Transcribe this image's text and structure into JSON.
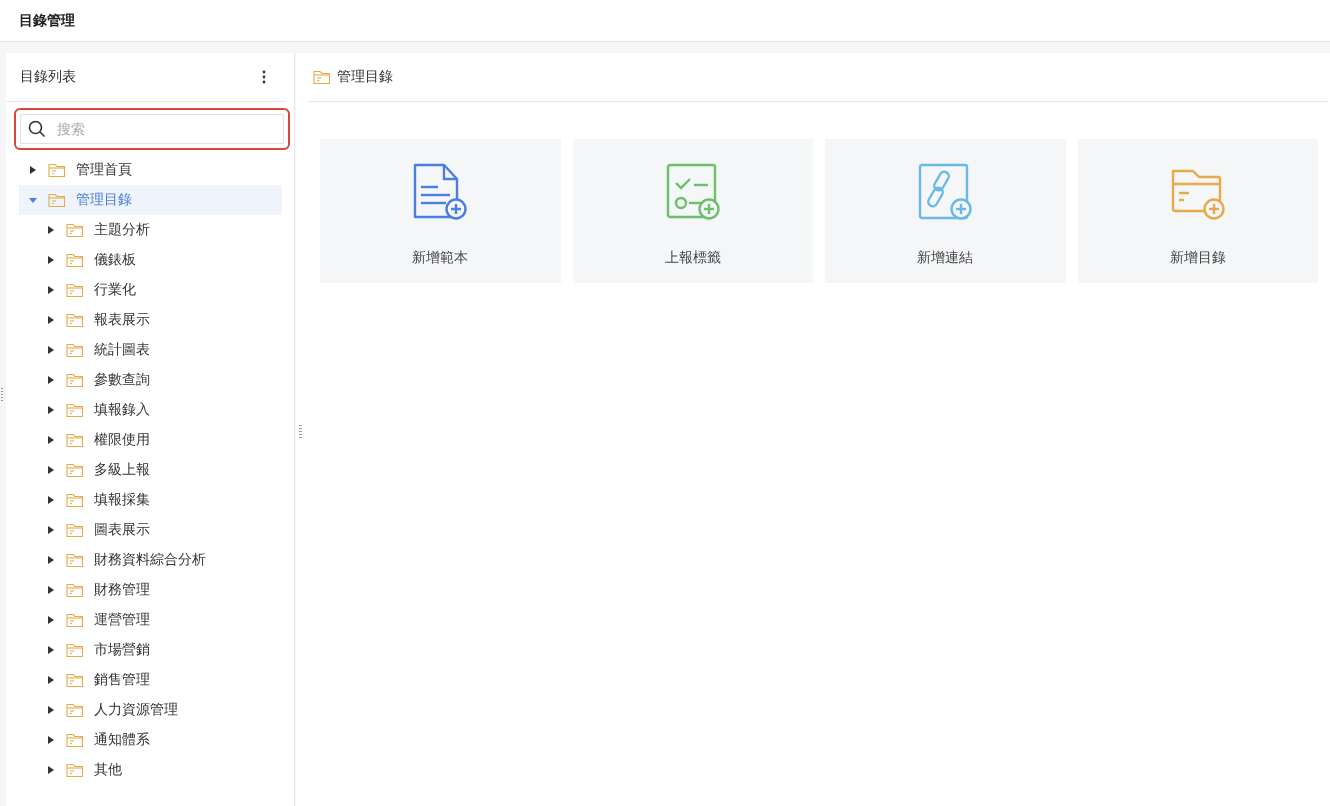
{
  "header": {
    "title": "目錄管理"
  },
  "sidebar": {
    "title": "目錄列表",
    "search": {
      "placeholder": "搜索",
      "highlighted": true
    },
    "tree": [
      {
        "label": "管理首頁",
        "expanded": false,
        "selected": false
      },
      {
        "label": "管理目錄",
        "expanded": true,
        "selected": true,
        "children": [
          {
            "label": "主題分析",
            "expanded": false,
            "selected": false
          },
          {
            "label": "儀錶板",
            "expanded": false,
            "selected": false
          },
          {
            "label": "行業化",
            "expanded": false,
            "selected": false
          },
          {
            "label": "報表展示",
            "expanded": false,
            "selected": false
          },
          {
            "label": "統計圖表",
            "expanded": false,
            "selected": false
          },
          {
            "label": "參數查詢",
            "expanded": false,
            "selected": false
          },
          {
            "label": "填報錄入",
            "expanded": false,
            "selected": false
          },
          {
            "label": "權限使用",
            "expanded": false,
            "selected": false
          },
          {
            "label": "多級上報",
            "expanded": false,
            "selected": false
          },
          {
            "label": "填報採集",
            "expanded": false,
            "selected": false
          },
          {
            "label": "圖表展示",
            "expanded": false,
            "selected": false
          },
          {
            "label": "財務資料綜合分析",
            "expanded": false,
            "selected": false
          },
          {
            "label": "財務管理",
            "expanded": false,
            "selected": false
          },
          {
            "label": "運營管理",
            "expanded": false,
            "selected": false
          },
          {
            "label": "市場營銷",
            "expanded": false,
            "selected": false
          },
          {
            "label": "銷售管理",
            "expanded": false,
            "selected": false
          },
          {
            "label": "人力資源管理",
            "expanded": false,
            "selected": false
          },
          {
            "label": "通知體系",
            "expanded": false,
            "selected": false
          },
          {
            "label": "其他",
            "expanded": false,
            "selected": false
          }
        ]
      }
    ]
  },
  "main": {
    "breadcrumb": "管理目錄",
    "cards": [
      {
        "kind": "template",
        "label": "新增範本"
      },
      {
        "kind": "report-tag",
        "label": "上報標籤"
      },
      {
        "kind": "link",
        "label": "新增連結"
      },
      {
        "kind": "folder",
        "label": "新增目錄"
      }
    ]
  }
}
